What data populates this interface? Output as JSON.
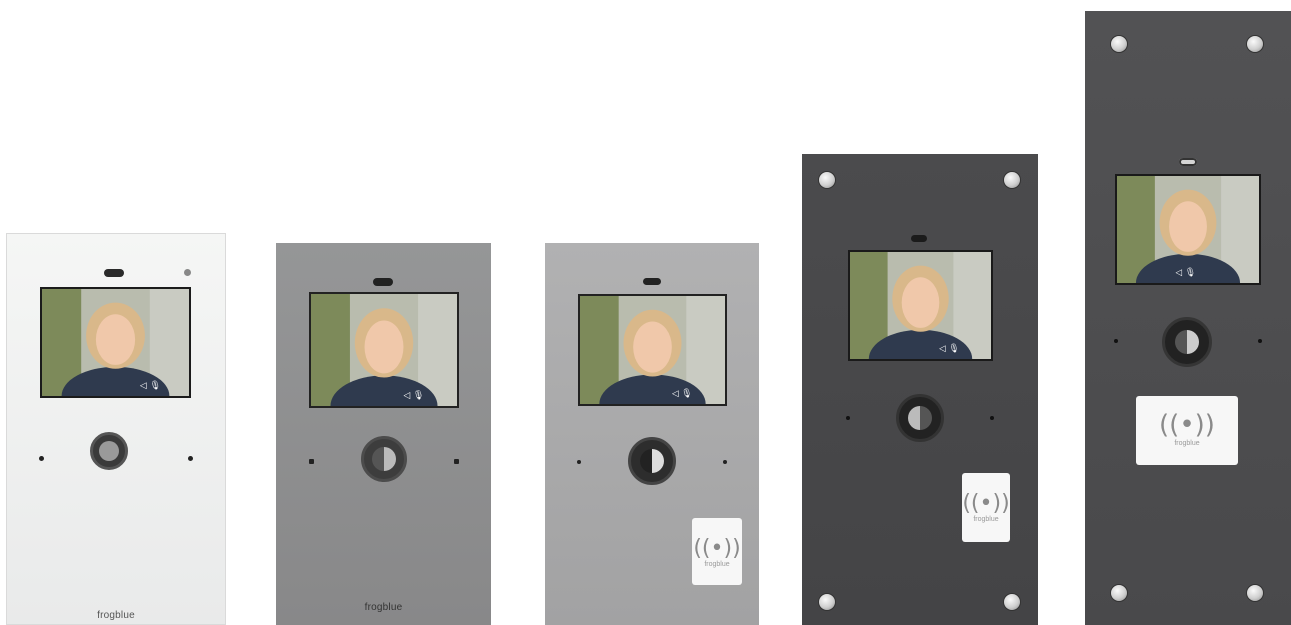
{
  "brand": "frogblue",
  "colors": {
    "white_glass": "#f1f2f1",
    "silver_grey": "#8e8f90",
    "aluminium": "#a9a9aa",
    "graphite": "#4a4a4c",
    "anthracite": "#4f4f51"
  },
  "panels": [
    {
      "variant": "white-glass",
      "has_rfid": false,
      "brand_label": "frogblue"
    },
    {
      "variant": "grey",
      "has_rfid": false,
      "brand_label": "frogblue"
    },
    {
      "variant": "aluminium",
      "has_rfid": true,
      "rfid_label": "frogblue"
    },
    {
      "variant": "graphite",
      "has_rfid": true,
      "rfid_label": "frogblue"
    },
    {
      "variant": "anthracite",
      "has_rfid": true,
      "rfid_label": "frogblue"
    }
  ],
  "icons": [
    "camera-icon",
    "speaker-icon",
    "microphone-icon",
    "rfid-icon",
    "screw-icon"
  ]
}
